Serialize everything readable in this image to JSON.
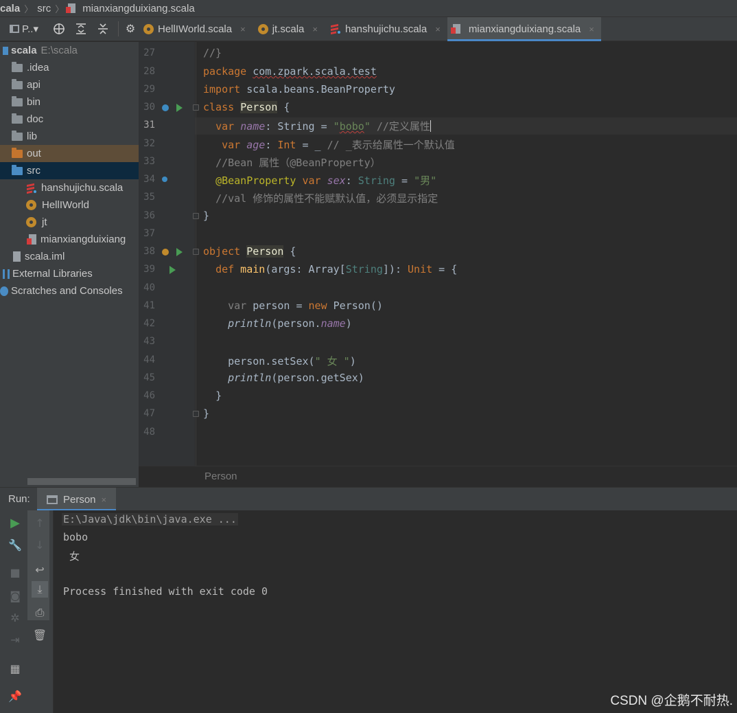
{
  "breadcrumb": {
    "project": "cala",
    "folder": "src",
    "file": "mianxiangduixiang.scala"
  },
  "toolbar": {
    "project_selector": "P..▾"
  },
  "tabs": [
    {
      "label": "HellIWorld.scala",
      "icon": "object-icon"
    },
    {
      "label": "jt.scala",
      "icon": "object-icon"
    },
    {
      "label": "hanshujichu.scala",
      "icon": "scala-file-icon"
    },
    {
      "label": "mianxiangduixiang.scala",
      "icon": "scala-file-icon",
      "active": true
    }
  ],
  "tab_close": "×",
  "project_tree": {
    "root_name": "scala",
    "root_path": "E:\\scala",
    "items": [
      {
        "label": ".idea"
      },
      {
        "label": "api"
      },
      {
        "label": "bin"
      },
      {
        "label": "doc"
      },
      {
        "label": "lib"
      },
      {
        "label": "out"
      },
      {
        "label": "src"
      },
      {
        "label": "hanshujichu.scala"
      },
      {
        "label": "HellIWorld"
      },
      {
        "label": "jt"
      },
      {
        "label": "mianxiangduixiang"
      },
      {
        "label": "scala.iml"
      },
      {
        "label": "External Libraries"
      },
      {
        "label": "Scratches and Consoles"
      }
    ]
  },
  "editor": {
    "line_numbers": [
      "27",
      "28",
      "29",
      "30",
      "31",
      "32",
      "33",
      "34",
      "35",
      "36",
      "37",
      "38",
      "39",
      "40",
      "41",
      "42",
      "43",
      "44",
      "45",
      "46",
      "47",
      "48"
    ],
    "current_line": "31",
    "tokens": {
      "l27": "//}",
      "l28_kw": "package",
      "l28_pkg": "com.zpark.scala.test",
      "l29_kw": "import",
      "l29_rest": " scala.beans.BeanProperty",
      "l30_kw": "class",
      "l30_name": "Person",
      "l30_brace": " {",
      "l31_kw": "var",
      "l31_field": "name",
      "l31_type": ": String = ",
      "l31_str_q1": "\"",
      "l31_str": "bobo",
      "l31_str_q2": "\"",
      "l31_cmt": " //定义属性",
      "l32_kw": "var",
      "l32_field": "age",
      "l32_colon": ": ",
      "l32_type": "Int",
      "l32_rest": " = _ ",
      "l32_cmt": "// _表示给属性一个默认值",
      "l33_cmt": "//Bean 属性（@BeanProperty）",
      "l34_ann": "@BeanProperty",
      "l34_kw": " var",
      "l34_field": "sex",
      "l34_colon": ": ",
      "l34_type": "String",
      "l34_eq": " = ",
      "l34_str": "\"男\"",
      "l35_cmt": "//val 修饰的属性不能赋默认值，必须显示指定",
      "l36": "}",
      "l38_kw": "object",
      "l38_name": "Person",
      "l38_brace": " {",
      "l39_kw": "def",
      "l39_fn": " main",
      "l39_a": "(args: Array[",
      "l39_t": "String",
      "l39_b": "]): ",
      "l39_unit": "Unit",
      "l39_c": " = {",
      "l41_kw": "var",
      "l41_a": " person = ",
      "l41_new": "new",
      "l41_b": " Person()",
      "l42_fn": "println",
      "l42_a": "(person.",
      "l42_field": "name",
      "l42_b": ")",
      "l44_a": "person.setSex(",
      "l44_str": "\" 女 \"",
      "l44_b": ")",
      "l45_fn": "println",
      "l45_a": "(person.getSex)",
      "l46": "}",
      "l47": "}"
    },
    "footer_breadcrumb": "Person"
  },
  "run_panel": {
    "label": "Run:",
    "tab_label": "Person",
    "console_lines": {
      "cmd": "E:\\Java\\jdk\\bin\\java.exe ...",
      "out1": "bobo",
      "out2": " 女",
      "exit": "Process finished with exit code 0"
    }
  },
  "watermark": "CSDN @企鹅不耐热.",
  "colors": {
    "keyword": "#cc7832",
    "string": "#6a8759",
    "comment": "#808080",
    "field": "#9876aa",
    "annotation": "#bbb529",
    "accent": "#4a88c7"
  }
}
